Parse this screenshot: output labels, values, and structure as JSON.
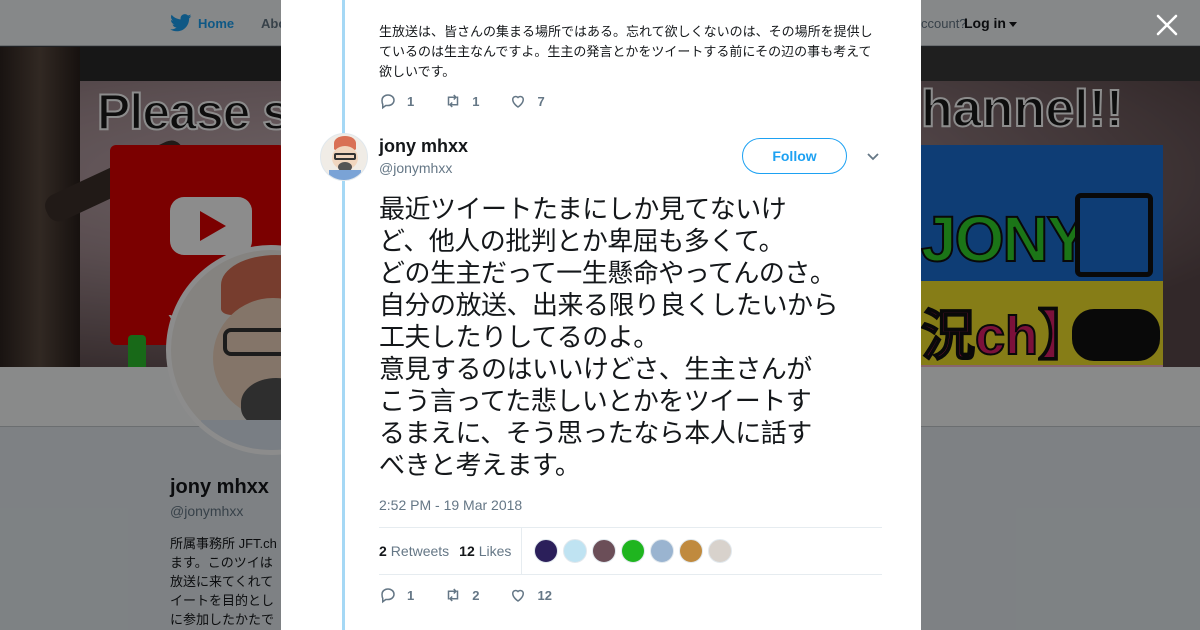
{
  "nav": {
    "home_label": "Home",
    "about_label": "Abo",
    "account_prompt": "ccount?",
    "login_label": "Log in"
  },
  "banner": {
    "please_text": "Please su",
    "channel_text": "hannel!!",
    "youtube_text": "Yo",
    "jony_text": "JONY",
    "jikkyo_text": "況ch】"
  },
  "background_profile": {
    "name": "jony mhxx",
    "handle": "@jonymhxx",
    "bio_lines": [
      "所属事務所 JFT.ch",
      "ます。このツイは",
      "放送に来てくれて",
      "イートを目的とし",
      "に参加したかたで"
    ]
  },
  "previous_tweet": {
    "text": "生放送は、皆さんの集まる場所ではある。忘れて欲しくないのは、その場所を提供しているのは生主なんですよ。生主の発言とかをツイートする前にその辺の事も考えて欲しいです。",
    "replies": "1",
    "retweets": "1",
    "likes": "7"
  },
  "tweet": {
    "author_name": "jony mhxx",
    "author_handle": "@jonymhxx",
    "follow_label": "Follow",
    "text": "最近ツイートたまにしか見てないけ\nど、他人の批判とか卑屈も多くて。\nどの生主だって一生懸命やってんのさ。\n自分の放送、出来る限り良くしたいから\n工夫したりしてるのよ。\n意見するのはいいけどさ、生主さんが\nこう言ってた悲しいとかをツイートす\nるまえに、そう思ったなら本人に話す\nべきと考えます。",
    "timestamp": "2:52 PM - 19 Mar 2018",
    "retweet_count": "2",
    "retweet_label": "Retweets",
    "like_count": "12",
    "like_label": "Likes",
    "liker_colors": [
      "#2b1f5a",
      "#bfe3f2",
      "#6b4e58",
      "#1fb51f",
      "#9ab4d0",
      "#c08a3e",
      "#d8d2cc"
    ],
    "replies": "1",
    "retweets": "2",
    "likes": "12"
  },
  "colors": {
    "accent": "#1da1f2",
    "thread_line": "#a5d8f5",
    "muted": "#657786"
  }
}
